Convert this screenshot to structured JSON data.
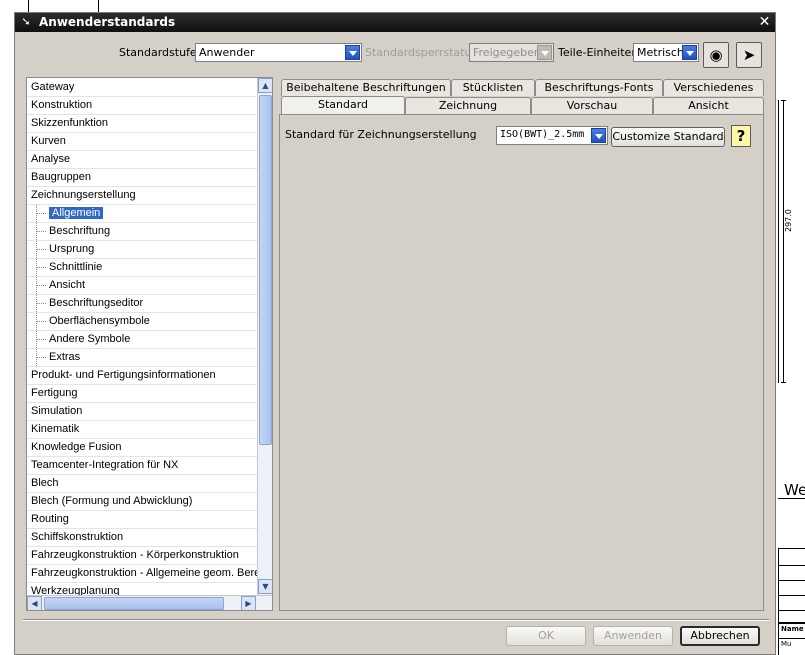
{
  "window": {
    "title": "Anwenderstandards",
    "close_symbol": "✕"
  },
  "header": {
    "standardstufe_label": "Standardstufe",
    "standardstufe_value": "Anwender",
    "sperrstatus_label": "Standardsperrstatus",
    "sperrstatus_value": "Freigegeben",
    "teile_einheiten_label": "Teile-Einheiten",
    "teile_einheiten_value": "Metrisch"
  },
  "tree": {
    "items": [
      {
        "label": "Gateway",
        "level": 0
      },
      {
        "label": "Konstruktion",
        "level": 0
      },
      {
        "label": "Skizzenfunktion",
        "level": 0
      },
      {
        "label": "Kurven",
        "level": 0
      },
      {
        "label": "Analyse",
        "level": 0
      },
      {
        "label": "Baugruppen",
        "level": 0
      },
      {
        "label": "Zeichnungserstellung",
        "level": 0
      },
      {
        "label": "Allgemein",
        "level": 1,
        "selected": true
      },
      {
        "label": "Beschriftung",
        "level": 1
      },
      {
        "label": "Ursprung",
        "level": 1
      },
      {
        "label": "Schnittlinie",
        "level": 1
      },
      {
        "label": "Ansicht",
        "level": 1
      },
      {
        "label": "Beschriftungseditor",
        "level": 1
      },
      {
        "label": "Oberflächensymbole",
        "level": 1
      },
      {
        "label": "Andere Symbole",
        "level": 1
      },
      {
        "label": "Extras",
        "level": 1
      },
      {
        "label": "Produkt- und Fertigungsinformationen",
        "level": 0
      },
      {
        "label": "Fertigung",
        "level": 0
      },
      {
        "label": "Simulation",
        "level": 0
      },
      {
        "label": "Kinematik",
        "level": 0
      },
      {
        "label": "Knowledge Fusion",
        "level": 0
      },
      {
        "label": "Teamcenter-Integration für NX",
        "level": 0
      },
      {
        "label": "Blech",
        "level": 0
      },
      {
        "label": "Blech (Formung und Abwicklung)",
        "level": 0
      },
      {
        "label": "Routing",
        "level": 0
      },
      {
        "label": "Schiffskonstruktion",
        "level": 0
      },
      {
        "label": "Fahrzeugkonstruktion - Körperkonstruktion",
        "level": 0
      },
      {
        "label": "Fahrzeugkonstruktion - Allgemeine geom. Berechnungen",
        "level": 0
      },
      {
        "label": "Werkzeugplanung",
        "level": 0
      }
    ]
  },
  "tabs": {
    "row1": [
      "Beibehaltene Beschriftungen",
      "Stücklisten",
      "Beschriftungs-Fonts",
      "Verschiedenes"
    ],
    "row2": [
      "Standard",
      "Zeichnung",
      "Vorschau",
      "Ansicht"
    ],
    "active": "Standard"
  },
  "panel": {
    "field_label": "Standard für Zeichnungserstellung",
    "field_value": "ISO(BWT)_2.5mm",
    "customize_label": "Customize Standard",
    "help_symbol": "?"
  },
  "footer": {
    "ok_label": "OK",
    "apply_label": "Anwenden",
    "cancel_label": "Abbrechen"
  },
  "background": {
    "dimension_text": "297.0",
    "partial_text": "We",
    "table_header": "Name",
    "table_sub": "Mu"
  },
  "icons": {
    "window_icon": "arrow-cursor-icon",
    "search_button": "binoculars-icon",
    "reset_button": "eraser-icon"
  },
  "colors": {
    "titlebar": "#161616",
    "selection": "#3168c6",
    "dialog_face": "#d4d0c8",
    "dropdown_arrow": "#2f5fd0"
  }
}
